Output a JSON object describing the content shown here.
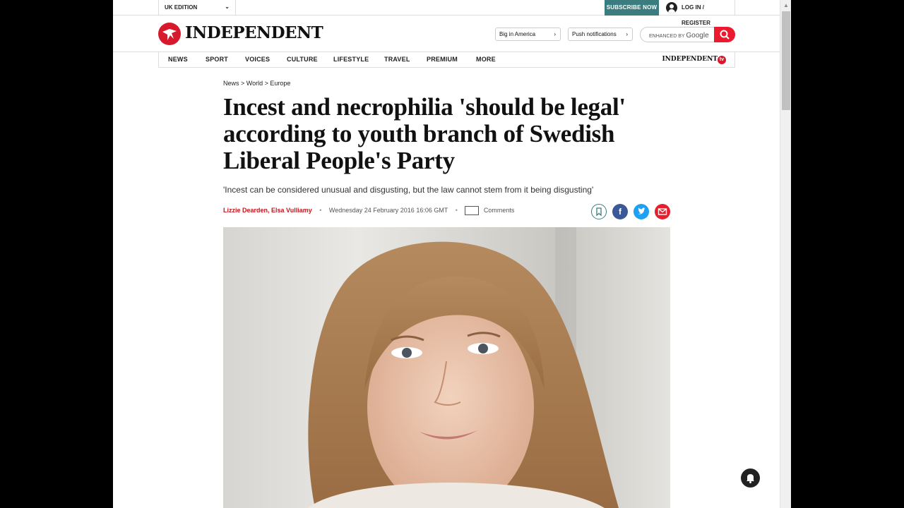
{
  "topbar": {
    "edition": "UK EDITION",
    "subscribe": "SUBSCRIBE NOW",
    "login": "LOG IN / REGISTER"
  },
  "masthead": {
    "logo_text": "INDEPENDENT",
    "pill_america": "Big in America",
    "pill_push": "Push notifications",
    "search_prefix": "ENHANCED BY",
    "search_brand": "Google"
  },
  "nav": {
    "items": [
      "NEWS",
      "SPORT",
      "VOICES",
      "CULTURE",
      "LIFESTYLE",
      "TRAVEL",
      "PREMIUM",
      "MORE"
    ],
    "tv_text": "INDEPENDENT",
    "tv_badge": "tv"
  },
  "article": {
    "breadcrumb": "News > World > Europe",
    "headline": "Incest and necrophilia 'should be legal' according to youth branch of Swedish Liberal People's Party",
    "standfirst": "'Incest can be considered unusual and disgusting, but the law cannot stem from it being disgusting'",
    "authors": "Lizzie Dearden, Elsa Vulliamy",
    "date": "Wednesday 24 February 2016 16:06 GMT",
    "comments": "Comments"
  },
  "colors": {
    "brand_red": "#d7192d",
    "subscribe_teal": "#3b7d7e",
    "facebook": "#3b5998",
    "twitter": "#1da1f2",
    "email": "#e5202e"
  }
}
